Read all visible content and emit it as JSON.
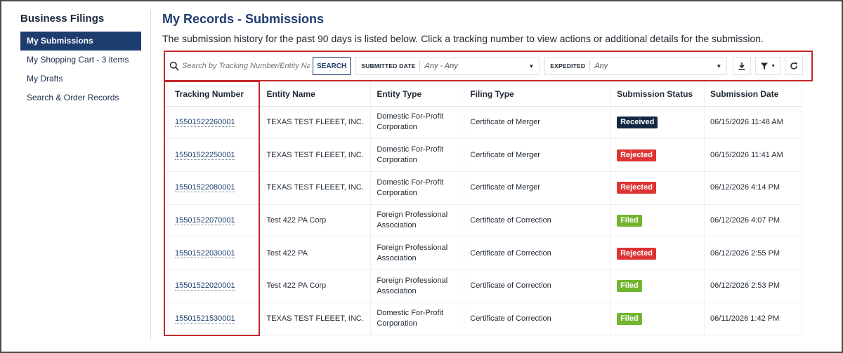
{
  "sidebar": {
    "title": "Business Filings",
    "items": [
      {
        "label": "My Submissions",
        "active": true
      },
      {
        "label": "My Shopping Cart - 3 items",
        "active": false
      },
      {
        "label": "My Drafts",
        "active": false
      },
      {
        "label": "Search & Order Records",
        "active": false
      }
    ]
  },
  "main": {
    "title": "My Records - Submissions",
    "description": "The submission history for the past 90 days is listed below. Click a tracking number to view actions or additional details for the submission."
  },
  "toolbar": {
    "search_placeholder": "Search by Tracking Number/Entity Name",
    "search_button": "SEARCH",
    "submitted_date_label": "SUBMITTED DATE",
    "submitted_date_value": "Any - Any",
    "expedited_label": "EXPEDITED",
    "expedited_value": "Any"
  },
  "table": {
    "headers": [
      "Tracking Number",
      "Entity Name",
      "Entity Type",
      "Filing Type",
      "Submission Status",
      "Submission Date"
    ],
    "rows": [
      {
        "tracking": "15501522260001",
        "entity": "TEXAS TEST FLEEET, INC.",
        "type": "Domestic For-Profit Corporation",
        "filing": "Certificate of Merger",
        "status": "Received",
        "status_kind": "received",
        "date": "06/15/2026 11:48 AM"
      },
      {
        "tracking": "15501522250001",
        "entity": "TEXAS TEST FLEEET, INC.",
        "type": "Domestic For-Profit Corporation",
        "filing": "Certificate of Merger",
        "status": "Rejected",
        "status_kind": "rejected",
        "date": "06/15/2026 11:41 AM"
      },
      {
        "tracking": "15501522080001",
        "entity": "TEXAS TEST FLEEET, INC.",
        "type": "Domestic For-Profit Corporation",
        "filing": "Certificate of Merger",
        "status": "Rejected",
        "status_kind": "rejected",
        "date": "06/12/2026 4:14 PM"
      },
      {
        "tracking": "15501522070001",
        "entity": "Test 422 PA Corp",
        "type": "Foreign Professional Association",
        "filing": "Certificate of Correction",
        "status": "Filed",
        "status_kind": "filed",
        "date": "06/12/2026 4:07 PM"
      },
      {
        "tracking": "15501522030001",
        "entity": "Test 422 PA",
        "type": "Foreign Professional Association",
        "filing": "Certificate of Correction",
        "status": "Rejected",
        "status_kind": "rejected",
        "date": "06/12/2026 2:55 PM"
      },
      {
        "tracking": "15501522020001",
        "entity": "Test 422 PA Corp",
        "type": "Foreign Professional Association",
        "filing": "Certificate of Correction",
        "status": "Filed",
        "status_kind": "filed",
        "date": "06/12/2026 2:53 PM"
      },
      {
        "tracking": "15501521530001",
        "entity": "TEXAS TEST FLEEET, INC.",
        "type": "Domestic For-Profit Corporation",
        "filing": "Certificate of Correction",
        "status": "Filed",
        "status_kind": "filed",
        "date": "06/11/2026 1:42 PM"
      }
    ]
  },
  "colors": {
    "brand": "#1d3d6e",
    "highlight": "#c62828",
    "received": "#142744",
    "rejected": "#dd3333",
    "filed": "#72b52e"
  },
  "icons": {
    "search": "search-icon",
    "download": "download-icon",
    "filter": "filter-icon",
    "refresh": "refresh-icon"
  }
}
